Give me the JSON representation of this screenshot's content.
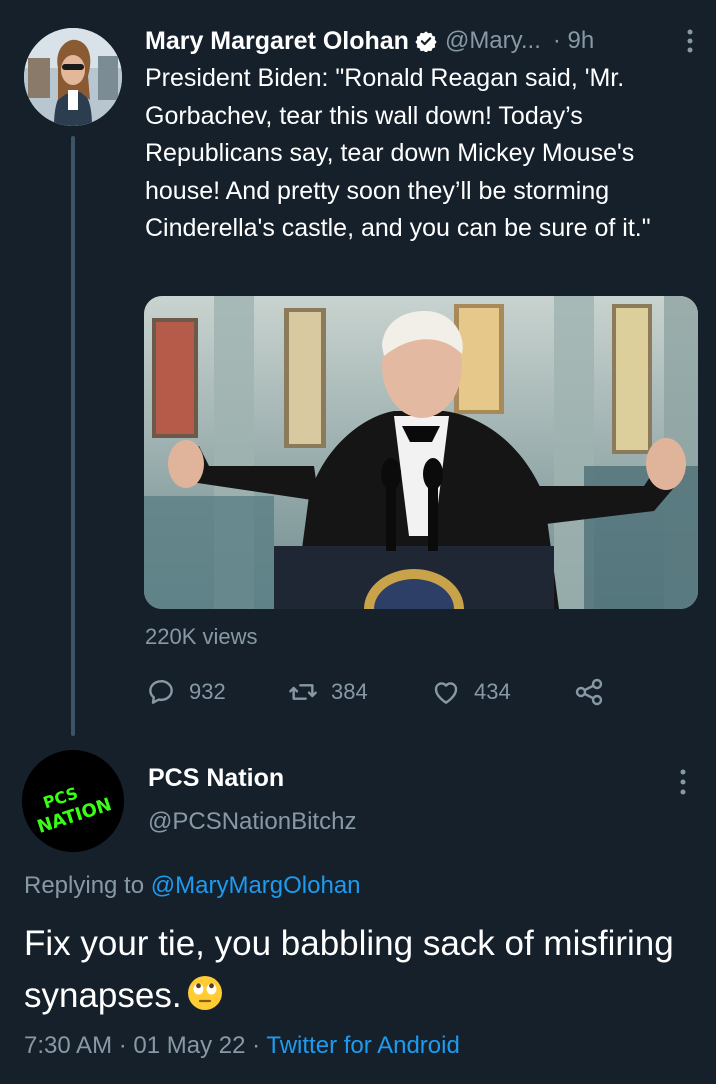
{
  "parent_tweet": {
    "author_name": "Mary Margaret Olohan",
    "handle": "@Mary...",
    "time": "9h",
    "separator": "·",
    "text": "President Biden: \"Ronald Reagan said, 'Mr. Gorbachev, tear this wall down! Today’s Republicans say, tear down Mickey Mouse's house! And pretty soon they’ll be storming Cinderella's castle, and you can be sure of it.\"",
    "views": "220K views",
    "stats": {
      "replies": "932",
      "retweets": "384",
      "likes": "434"
    }
  },
  "reply_tweet": {
    "author_name": "PCS Nation",
    "handle": "@PCSNationBitchz",
    "avatar_text_1": "PCS",
    "avatar_text_2": "NATION",
    "replying_prefix": "Replying to",
    "replying_to": "@MaryMargOlohan",
    "text": "Fix your tie, you babbling sack of misfiring synapses.",
    "time": "7:30 AM",
    "date": "01 May 22",
    "separator": "·",
    "source": "Twitter for Android"
  },
  "colors": {
    "background": "#15202b",
    "secondary_text": "#8899a6",
    "link": "#1d9bf0",
    "avatar_text": "#39ff14"
  },
  "icons": [
    "verified-badge-icon",
    "more-vertical-icon",
    "reply-icon",
    "retweet-icon",
    "like-icon",
    "share-icon",
    "eye-roll-emoji"
  ]
}
